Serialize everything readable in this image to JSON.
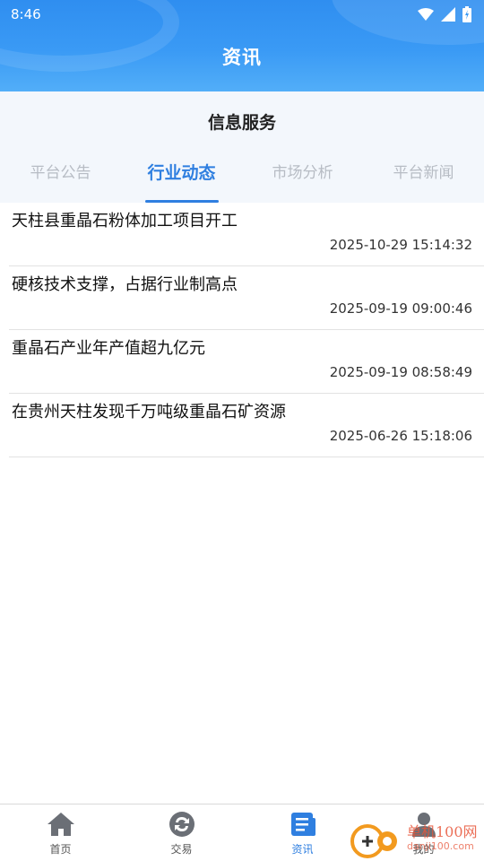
{
  "status": {
    "time": "8:46",
    "icons": [
      "wifi-icon",
      "signal-icon",
      "battery-icon"
    ]
  },
  "header": {
    "title": "资讯"
  },
  "section": {
    "title": "信息服务"
  },
  "tabs": [
    {
      "label": "平台公告",
      "active": false
    },
    {
      "label": "行业动态",
      "active": true
    },
    {
      "label": "市场分析",
      "active": false
    },
    {
      "label": "平台新闻",
      "active": false
    }
  ],
  "news": [
    {
      "title": "天柱县重晶石粉体加工项目开工",
      "date": "2025-10-29 15:14:32"
    },
    {
      "title": "硬核技术支撑，占据行业制高点",
      "date": "2025-09-19 09:00:46"
    },
    {
      "title": "重晶石产业年产值超九亿元",
      "date": "2025-09-19 08:58:49"
    },
    {
      "title": "在贵州天柱发现千万吨级重晶石矿资源",
      "date": "2025-06-26 15:18:06"
    }
  ],
  "tabbar": [
    {
      "label": "首页",
      "icon": "home-icon"
    },
    {
      "label": "交易",
      "icon": "exchange-icon"
    },
    {
      "label": "资讯",
      "icon": "news-icon",
      "active": true
    },
    {
      "label": "我的",
      "icon": "profile-icon"
    }
  ],
  "watermark": {
    "text": "单机100网",
    "url": "danji100.com"
  },
  "colors": {
    "accent": "#2f7fe0",
    "header": "#3a9af5",
    "inactive_tab": "#b7bcc4"
  }
}
